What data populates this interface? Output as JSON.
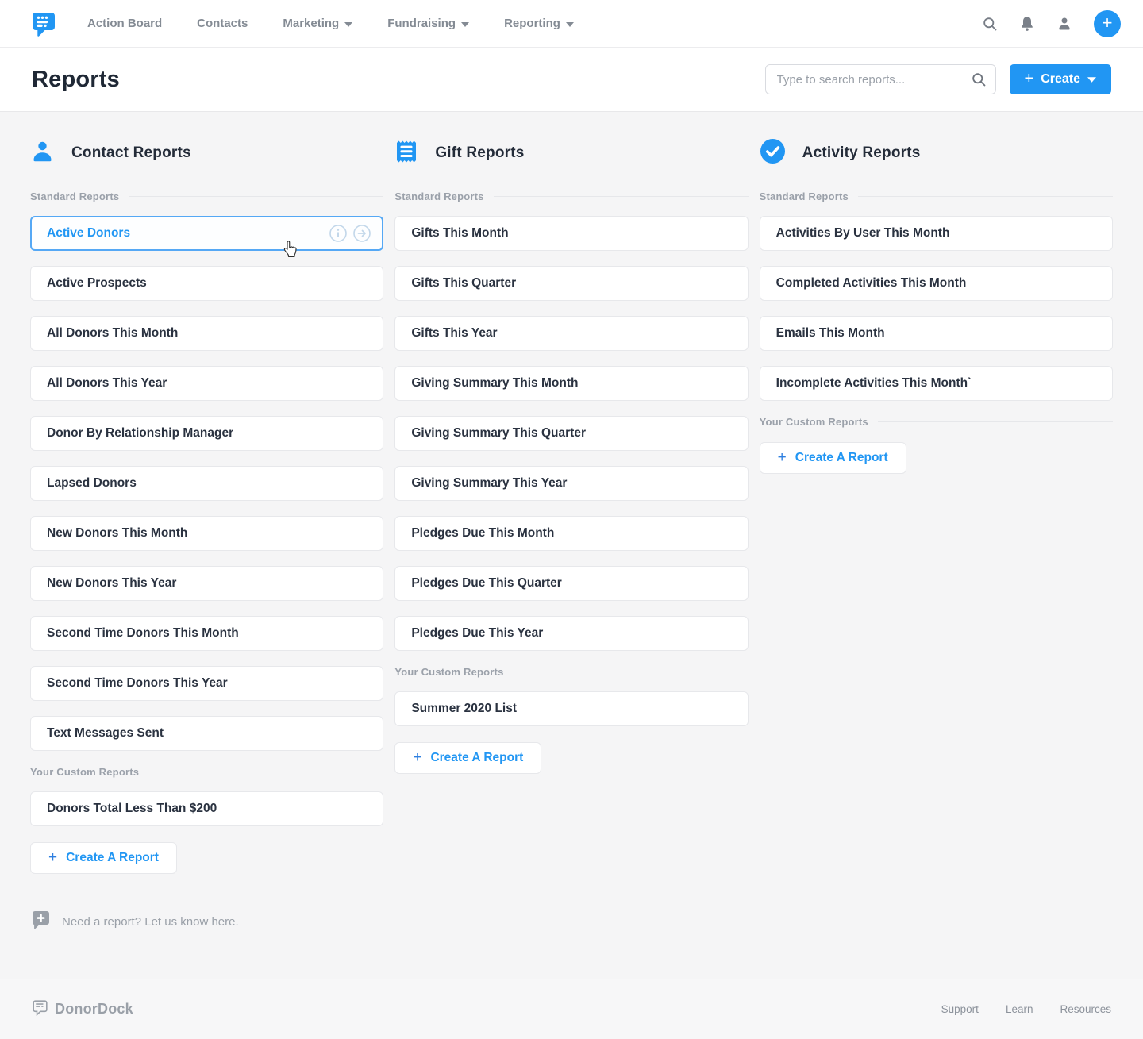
{
  "brand": {
    "name": "DonorDock",
    "accent_color": "#2196f3"
  },
  "nav": {
    "items": [
      {
        "label": "Action Board"
      },
      {
        "label": "Contacts"
      },
      {
        "label": "Marketing"
      },
      {
        "label": "Fundraising"
      },
      {
        "label": "Reporting"
      }
    ]
  },
  "header": {
    "title": "Reports",
    "search_placeholder": "Type to search reports...",
    "create_button_label": "Create"
  },
  "selected_report": "Active Donors",
  "columns": [
    {
      "title": "Contact Reports",
      "icon": "contact-person-icon",
      "standard_label": "Standard Reports",
      "standard_reports": [
        "Active Donors",
        "Active Prospects",
        "All Donors This Month",
        "All Donors This Year",
        "Donor By Relationship Manager",
        "Lapsed Donors",
        "New Donors This Month",
        "New Donors This Year",
        "Second Time Donors This Month",
        "Second Time Donors This Year",
        "Text Messages Sent"
      ],
      "custom_label": "Your Custom Reports",
      "custom_reports": [
        "Donors Total Less Than $200"
      ],
      "create_button_label": "Create A Report"
    },
    {
      "title": "Gift Reports",
      "icon": "receipt-icon",
      "standard_label": "Standard Reports",
      "standard_reports": [
        "Gifts This Month",
        "Gifts This Quarter",
        "Gifts This Year",
        "Giving Summary This Month",
        "Giving Summary This Quarter",
        "Giving Summary This Year",
        "Pledges Due This Month",
        "Pledges Due This Quarter",
        "Pledges Due This Year"
      ],
      "custom_label": "Your Custom Reports",
      "custom_reports": [
        "Summer 2020 List"
      ],
      "create_button_label": "Create A Report"
    },
    {
      "title": "Activity Reports",
      "icon": "check-circle-icon",
      "standard_label": "Standard Reports",
      "standard_reports": [
        "Activities By User This Month",
        "Completed Activities This Month",
        "Emails This Month",
        "Incomplete Activities This Month`"
      ],
      "custom_label": "Your Custom Reports",
      "custom_reports": [],
      "create_button_label": "Create A Report"
    }
  ],
  "need_report_text": "Need a report? Let us know here.",
  "footer": {
    "brand": "DonorDock",
    "links": [
      "Support",
      "Learn",
      "Resources"
    ]
  }
}
